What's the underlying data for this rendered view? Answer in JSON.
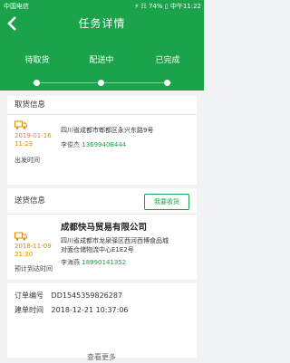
{
  "statusbar": {
    "carrier": "中国电信",
    "right": "⚡ ☷ 74% ▯ 中午11:22"
  },
  "header": {
    "title": "任务详情"
  },
  "tabs": {
    "items": [
      "待取货",
      "配送中",
      "已完成"
    ]
  },
  "pickup": {
    "title": "取货信息",
    "date": "2019-01-16",
    "time": "11:23",
    "time_label": "出发时间",
    "address": "四川省成都市郫都区永兴东路9号",
    "contact_name": "李俊杰",
    "contact_phone": "13699408444"
  },
  "delivery": {
    "title": "送货信息",
    "confirm_label": "我要收货",
    "company": "成都快马贸易有限公司",
    "date": "2018-11-09",
    "time": "21:30",
    "time_label": "预计到达时间",
    "address_line1": "四川省成都市龙泉驿区西河西博食品城",
    "address_line2": "对面仓储物流中心E1E2号",
    "contact_name": "李海燕",
    "contact_phone": "18990141352"
  },
  "order": {
    "number_label": "订单编号",
    "number": "DD1545359826287",
    "created_label": "建单时间",
    "created": "2018-12-21 10:37:06",
    "bottom_label": "查看更多"
  },
  "colors": {
    "brand_green": "#1aa34a",
    "time_orange": "#e08a00"
  }
}
